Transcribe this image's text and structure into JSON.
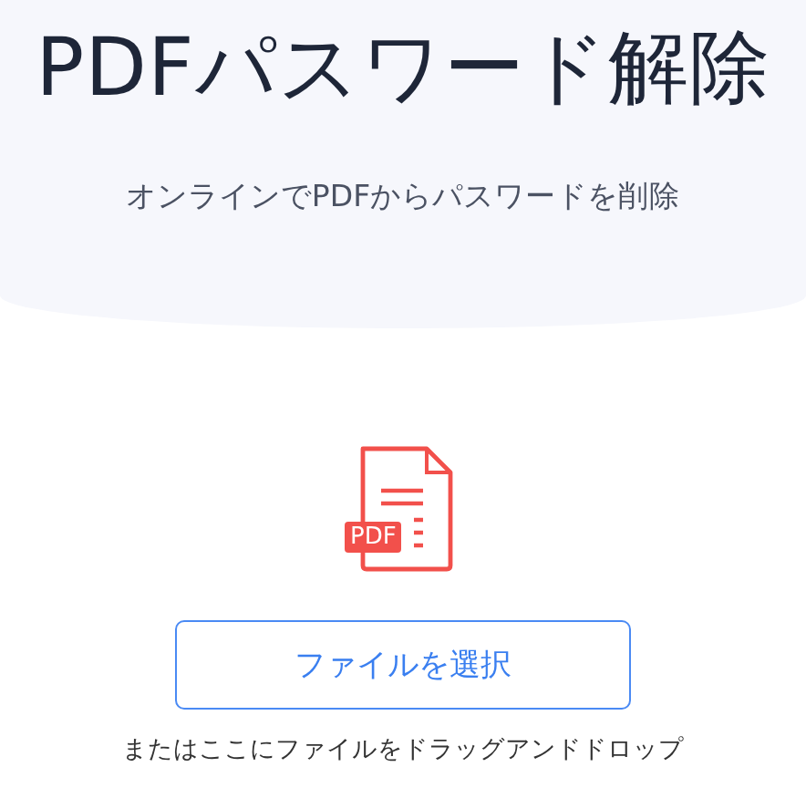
{
  "title": "PDFパスワード解除",
  "subtitle": "オンラインでPDFからパスワードを削除",
  "file_icon": {
    "badge": "PDF"
  },
  "select_button": {
    "label": "ファイルを選択"
  },
  "drop_hint": "またはここにファイルをドラッグアンドドロップ"
}
